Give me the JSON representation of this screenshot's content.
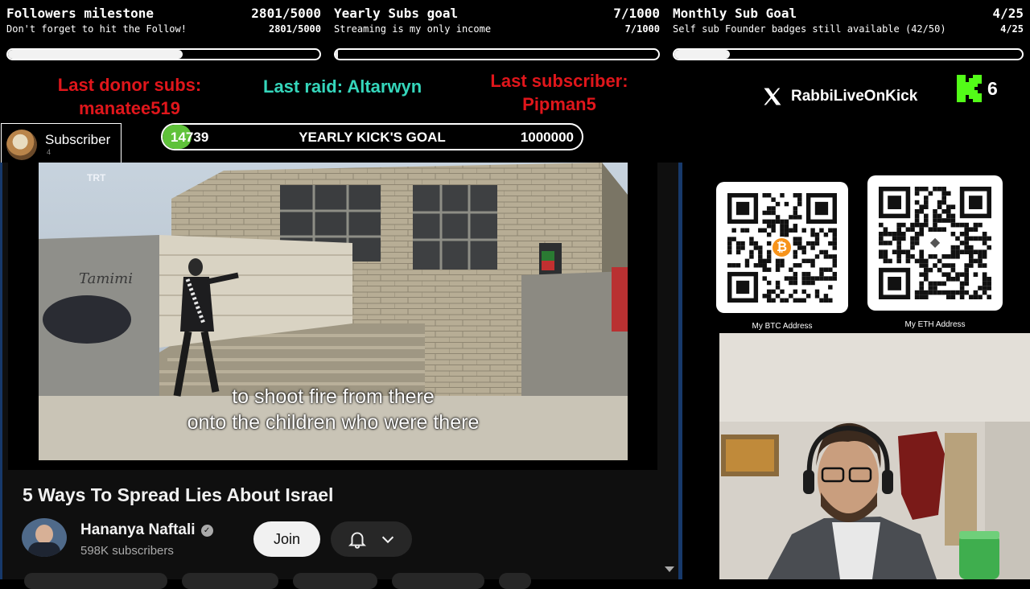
{
  "goals": [
    {
      "title": "Followers milestone",
      "count": "2801/5000",
      "subtitle": "Don't forget to hit the Follow!",
      "count2": "2801/5000",
      "progress": 0.56
    },
    {
      "title": "Yearly Subs goal",
      "count": "7/1000",
      "subtitle": "Streaming is my only income",
      "count2": "7/1000",
      "progress": 0.007
    },
    {
      "title": "Monthly Sub Goal",
      "count": "4/25",
      "subtitle": "Self sub Founder badges still available (42/50)",
      "count2": "4/25",
      "progress": 0.16
    }
  ],
  "alerts": {
    "donor_label": "Last donor subs:",
    "donor_name": "manatee519",
    "raid": "Last raid: Altarwyn",
    "subscriber_label": "Last subscriber:",
    "subscriber_name": "Pipman5"
  },
  "subscriber_widget": {
    "label": "Subscriber",
    "count": "4"
  },
  "kick_goal": {
    "current": "14739",
    "label": "YEARLY KICK'S GOAL",
    "target": "1000000",
    "progress": 0.0147
  },
  "social": {
    "handle": "RabbiLiveOnKick",
    "kick_viewers": "6"
  },
  "video": {
    "channel_logo": "TRT",
    "graffiti": "Tamimi",
    "subtitle_line1": "to shoot fire from there",
    "subtitle_line2": "onto the children who were there",
    "title": "5 Ways To Spread Lies About Israel",
    "channel_name": "Hananya Naftali",
    "subscribers": "598K subscribers",
    "join_label": "Join"
  },
  "qr": {
    "btc_label": "My BTC Address",
    "eth_label": "My ETH Address",
    "btc_symbol": "₿",
    "eth_symbol": "◆"
  },
  "colors": {
    "alert_red": "#e0161b",
    "raid_teal": "#35d6bb",
    "kick_green": "#53fc18",
    "btc_orange": "#f7931a",
    "youtube_blue": "#3ea6ff"
  }
}
